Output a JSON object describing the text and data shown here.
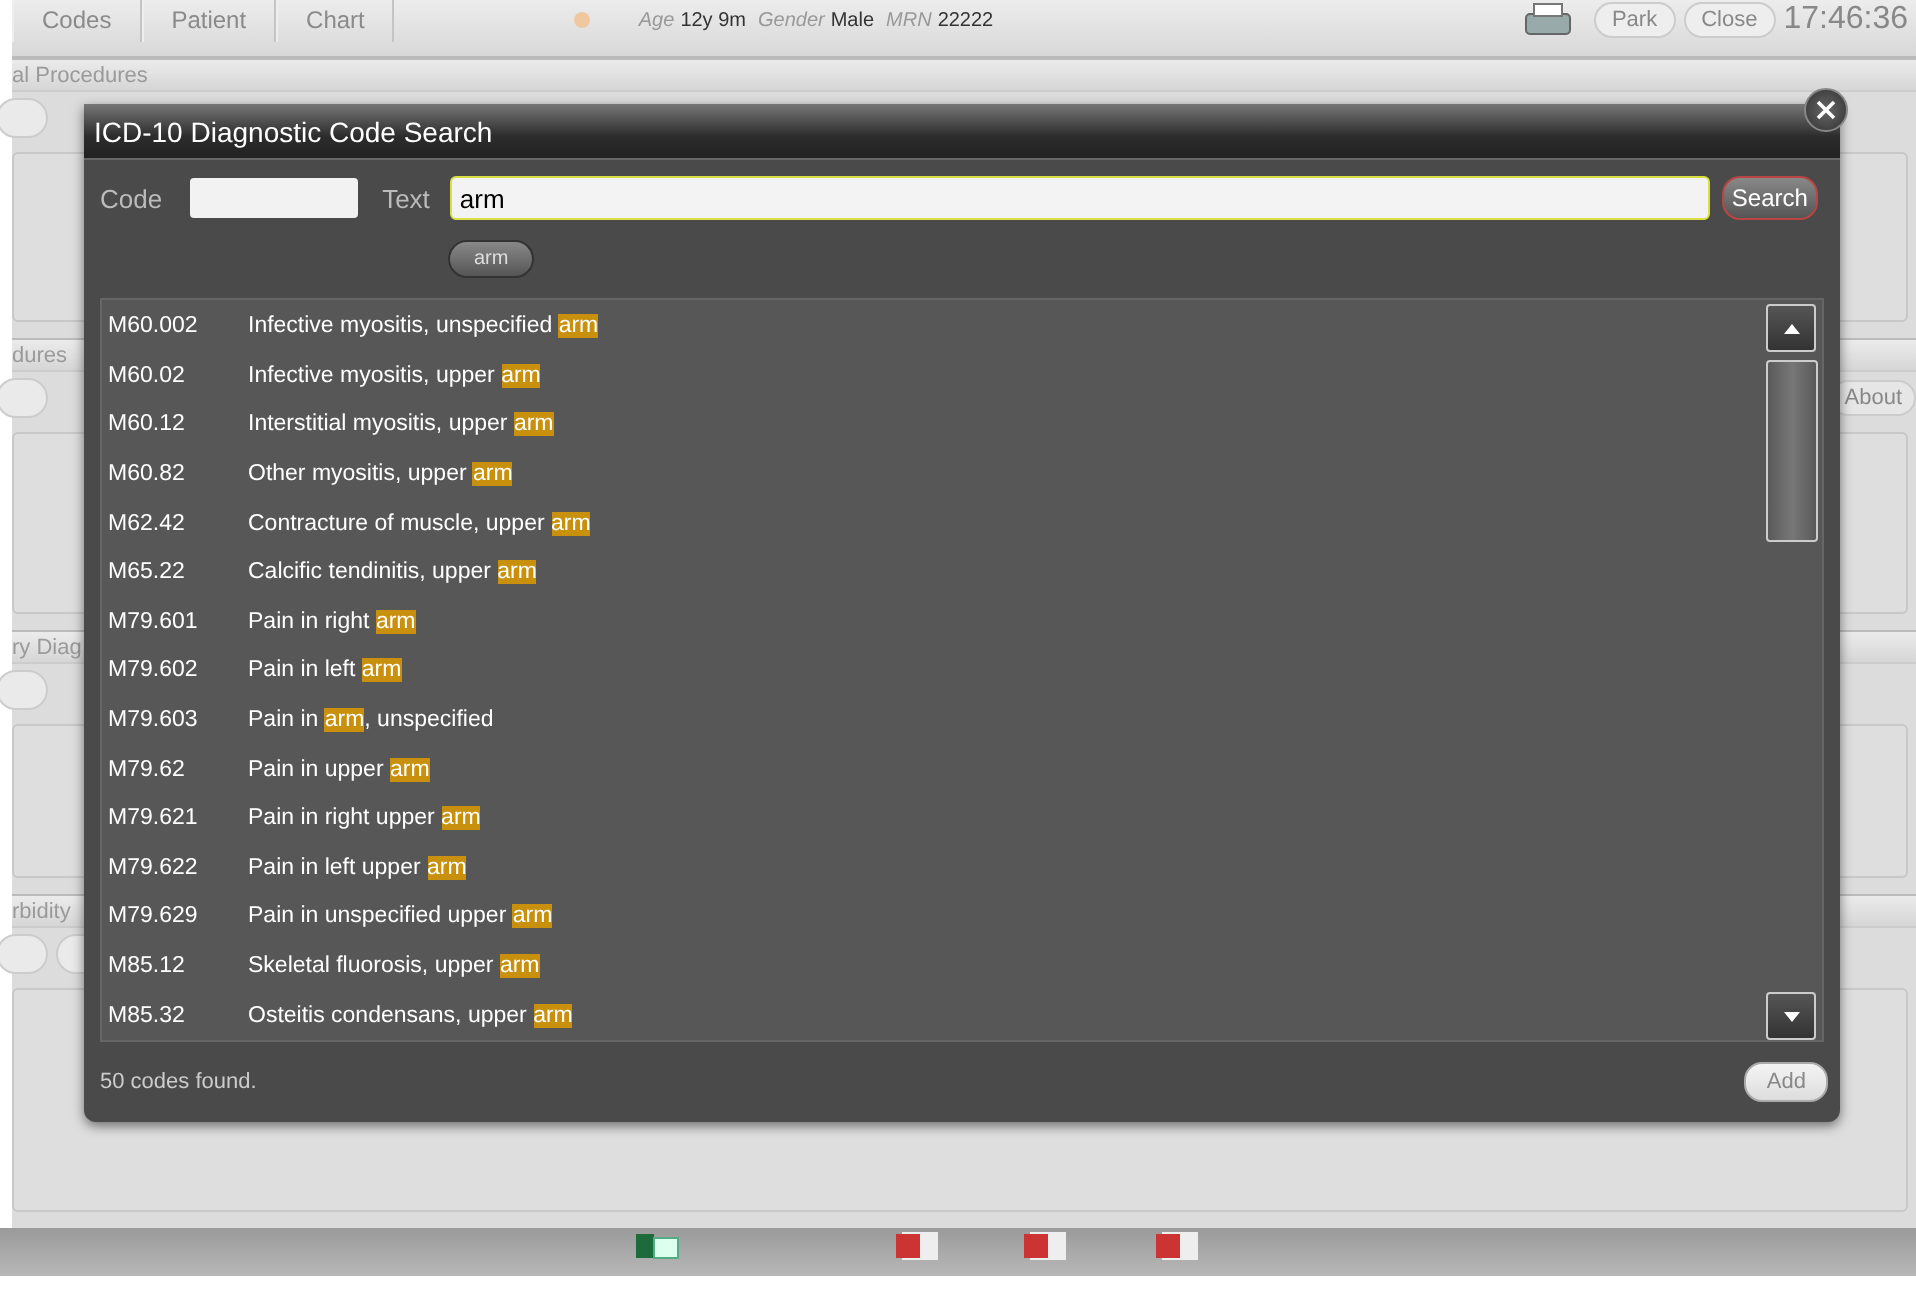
{
  "app_header": {
    "tabs": [
      "Codes",
      "Patient",
      "Chart"
    ],
    "patient": [
      {
        "label": "Age",
        "value": "12y 9m"
      },
      {
        "label": "Gender",
        "value": "Male"
      },
      {
        "label": "MRN",
        "value": "22222"
      }
    ],
    "buttons": [
      "Park",
      "Close"
    ],
    "time": "17:46:36"
  },
  "background_sections": [
    {
      "title": "al Procedures"
    },
    {
      "title": "dures",
      "side_button": "About"
    },
    {
      "title": "ry Diag"
    },
    {
      "title": "rbidity"
    }
  ],
  "dialog": {
    "title": "ICD-10 Diagnostic Code Search",
    "code_field": {
      "label": "Code"
    },
    "text_field": {
      "label": "Text",
      "value": "arm"
    },
    "search_button": "Search",
    "chips": [
      "arm"
    ],
    "results": [
      {
        "code": "M60.002",
        "before": "Infective myositis, unspecified ",
        "match": "arm"
      },
      {
        "code": "M60.02",
        "before": "Infective myositis, upper ",
        "match": "arm"
      },
      {
        "code": "M60.12",
        "before": "Interstitial myositis, upper ",
        "match": "arm"
      },
      {
        "code": "M60.82",
        "before": "Other myositis, upper ",
        "match": "arm"
      },
      {
        "code": "M62.42",
        "before": "Contracture of muscle, upper ",
        "match": "arm"
      },
      {
        "code": "M65.22",
        "before": "Calcific tendinitis, upper ",
        "match": "arm"
      },
      {
        "code": "M79.601",
        "before": "Pain in right ",
        "match": "arm"
      },
      {
        "code": "M79.602",
        "before": "Pain in left ",
        "match": "arm"
      },
      {
        "code": "M79.603",
        "before": "Pain in ",
        "match": "arm",
        "after": ", unspecified"
      },
      {
        "code": "M79.62",
        "before": "Pain in upper ",
        "match": "arm"
      },
      {
        "code": "M79.621",
        "before": "Pain in right upper ",
        "match": "arm"
      },
      {
        "code": "M79.622",
        "before": "Pain in left upper ",
        "match": "arm"
      },
      {
        "code": "M79.629",
        "before": "Pain in unspecified upper ",
        "match": "arm"
      },
      {
        "code": "M85.12",
        "before": "Skeletal fluorosis, upper ",
        "match": "arm"
      },
      {
        "code": "M85.32",
        "before": "Osteitis condensans, upper ",
        "match": "arm"
      }
    ],
    "status": "50 codes found.",
    "add_button": {
      "label": "Add",
      "disabled": true
    }
  },
  "taskbar": [
    {
      "kind": "spreadsheet"
    },
    {
      "kind": "slides"
    },
    {
      "kind": "slides"
    },
    {
      "kind": "slides"
    }
  ]
}
